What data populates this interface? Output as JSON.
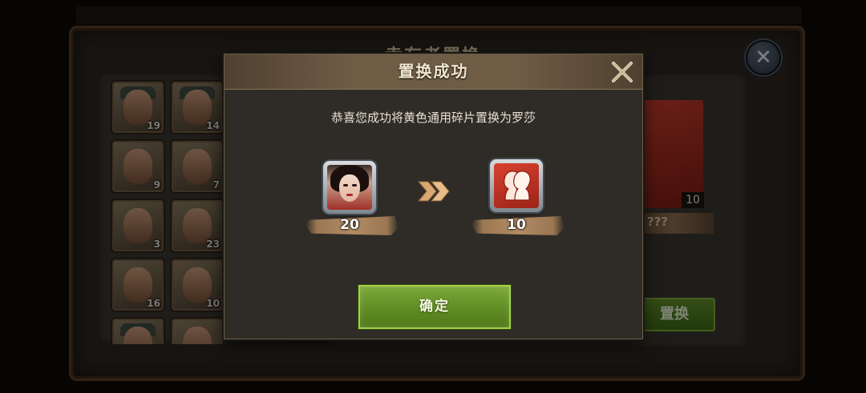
{
  "background": {
    "title": "幸存者置换",
    "thumb_counts": [
      "19",
      "14",
      "9",
      "7",
      "3",
      "23",
      "16",
      "10"
    ],
    "card_count": "10",
    "card_name": "???",
    "swap_button_label": "置换"
  },
  "dialog": {
    "title": "置换成功",
    "message": "恭喜您成功将黄色通用碎片置换为罗莎",
    "from_item": {
      "icon": "rosa-portrait",
      "count": "20"
    },
    "to_item": {
      "icon": "red-shard-silhouette",
      "count": "10"
    },
    "confirm_label": "确定"
  },
  "colors": {
    "confirm_green": "#6b9a2a",
    "header_brown": "#6e5c45",
    "shard_red": "#c23b2c"
  }
}
